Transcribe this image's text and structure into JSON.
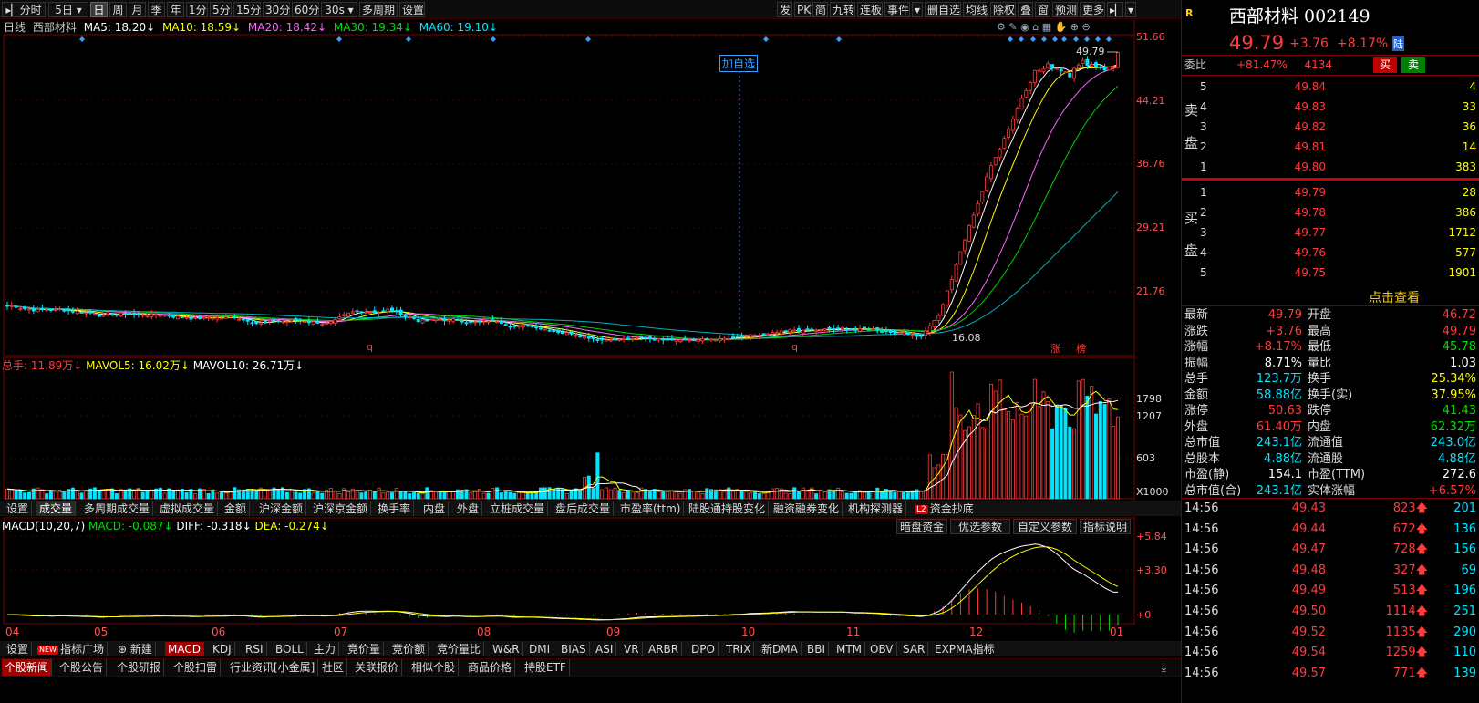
{
  "toolbar": {
    "items": [
      "分时",
      "5日",
      "日",
      "周",
      "月",
      "季",
      "年",
      "1分",
      "5分",
      "15分",
      "30分",
      "60分",
      "30s",
      "多周期",
      "设置"
    ],
    "active": "日",
    "right_items": [
      "发",
      "PK",
      "简",
      "九转",
      "连板",
      "事件",
      "删自选",
      "均线",
      "除权",
      "叠",
      "窗",
      "预测",
      "更多"
    ]
  },
  "ma_line": {
    "period": "日线",
    "name": "西部材料",
    "ma5": "MA5: 18.20↓",
    "ma10": "MA10: 18.59↓",
    "ma20": "MA20: 18.42↓",
    "ma30": "MA30: 19.34↓",
    "ma60": "MA60: 19.10↓"
  },
  "price_axis": [
    "51.66",
    "44.21",
    "36.76",
    "29.21",
    "21.76"
  ],
  "price_annot": {
    "high": "49.79",
    "low": "16.08",
    "add_fav": "加自选",
    "q1": "q",
    "q2": "q",
    "zhang": "涨",
    "bang": "榜"
  },
  "vol_line": {
    "total": "总手: 11.89万↓",
    "mavol5": "MAVOL5: 16.02万↓",
    "mavol10": "MAVOL10: 26.71万↓"
  },
  "vol_axis": [
    "1798",
    "1207",
    "603",
    "X1000"
  ],
  "indicator_tabs": [
    "设置",
    "成交量",
    "多周期成交量",
    "虚拟成交量",
    "金额",
    "沪深金额",
    "沪深京金额",
    "换手率",
    "内盘",
    "外盘",
    "立桩成交量",
    "盘后成交量",
    "市盈率(ttm)",
    "陆股通持股变化",
    "融资融券变化",
    "机构探测器",
    "资金抄底"
  ],
  "indicator_active": "成交量",
  "macd_line": {
    "label": "MACD(10,20,7)",
    "macd": "MACD: -0.087↓",
    "diff": "DIFF: -0.318↓",
    "dea": "DEA: -0.274↓"
  },
  "macd_buttons": [
    "暗盘资金",
    "优选参数",
    "自定义参数",
    "指标说明"
  ],
  "macd_axis": [
    "+5.84",
    "+3.30",
    "+0"
  ],
  "months": [
    "04",
    "05",
    "06",
    "07",
    "08",
    "09",
    "10",
    "11",
    "12",
    "01"
  ],
  "bottom_tabs": [
    "设置",
    "指标广场",
    "新建",
    "MACD",
    "KDJ",
    "RSI",
    "BOLL",
    "主力",
    "竞价量",
    "竞价额",
    "竞价量比",
    "W&R",
    "DMI",
    "BIAS",
    "ASI",
    "VR",
    "ARBR",
    "DPO",
    "TRIX",
    "新DMA",
    "BBI",
    "MTM",
    "OBV",
    "SAR",
    "EXPMA指标"
  ],
  "bottom_active": "MACD",
  "news_tabs": [
    "个股新闻",
    "个股公告",
    "个股研报",
    "个股扫雷",
    "行业资讯[小金属]",
    "社区",
    "关联报价",
    "相似个股",
    "商品价格",
    "持股ETF"
  ],
  "news_active": "个股新闻",
  "stock": {
    "r": "R",
    "name": "西部材料 002149",
    "price": "49.79",
    "change": "+3.76",
    "pct": "+8.17%",
    "lu": "陆"
  },
  "weibi": {
    "label": "委比",
    "pct": "+81.47%",
    "num": "4134",
    "buy": "买",
    "sell": "卖"
  },
  "sell_label": [
    "卖",
    "盘"
  ],
  "buy_label": [
    "买",
    "盘"
  ],
  "asks": [
    {
      "lv": "5",
      "p": "49.84",
      "v": "4"
    },
    {
      "lv": "4",
      "p": "49.83",
      "v": "33"
    },
    {
      "lv": "3",
      "p": "49.82",
      "v": "36"
    },
    {
      "lv": "2",
      "p": "49.81",
      "v": "14"
    },
    {
      "lv": "1",
      "p": "49.80",
      "v": "383"
    }
  ],
  "bids": [
    {
      "lv": "1",
      "p": "49.79",
      "v": "28"
    },
    {
      "lv": "2",
      "p": "49.78",
      "v": "386"
    },
    {
      "lv": "3",
      "p": "49.77",
      "v": "1712"
    },
    {
      "lv": "4",
      "p": "49.76",
      "v": "577"
    },
    {
      "lv": "5",
      "p": "49.75",
      "v": "1901"
    }
  ],
  "view_more": "点击查看",
  "quote": [
    [
      "最新",
      "49.79",
      "开盘",
      "46.72"
    ],
    [
      "涨跌",
      "+3.76",
      "最高",
      "49.79"
    ],
    [
      "涨幅",
      "+8.17%",
      "最低",
      "45.78"
    ],
    [
      "振幅",
      "8.71%",
      "量比",
      "1.03"
    ],
    [
      "总手",
      "123.7万",
      "换手",
      "25.34%"
    ],
    [
      "金额",
      "58.88亿",
      "换手(实)",
      "37.95%"
    ],
    [
      "涨停",
      "50.63",
      "跌停",
      "41.43"
    ],
    [
      "外盘",
      "61.40万",
      "内盘",
      "62.32万"
    ],
    [
      "总市值",
      "243.1亿",
      "流通值",
      "243.0亿"
    ],
    [
      "总股本",
      "4.88亿",
      "流通股",
      "4.88亿"
    ],
    [
      "市盈(静)",
      "154.1",
      "市盈(TTM)",
      "272.6"
    ],
    [
      "总市值(合)",
      "243.1亿",
      "实体涨幅",
      "+6.57%"
    ]
  ],
  "ticks": [
    [
      "14:56",
      "49.43",
      "823",
      "201"
    ],
    [
      "14:56",
      "49.44",
      "672",
      "136"
    ],
    [
      "14:56",
      "49.47",
      "728",
      "156"
    ],
    [
      "14:56",
      "49.48",
      "327",
      "69"
    ],
    [
      "14:56",
      "49.49",
      "513",
      "196"
    ],
    [
      "14:56",
      "49.50",
      "1114",
      "251"
    ],
    [
      "14:56",
      "49.52",
      "1135",
      "290"
    ],
    [
      "14:56",
      "49.54",
      "1259",
      "110"
    ],
    [
      "14:56",
      "49.57",
      "771",
      "139"
    ]
  ],
  "colors": {
    "up": "#ff3b3b",
    "down": "#00e5ff",
    "ma5": "#ffffff",
    "ma10": "#ffff00",
    "ma20": "#ff66ff",
    "ma30": "#00d000",
    "ma60": "#00b0c0",
    "frame": "#800000"
  },
  "chart_data": {
    "type": "candlestick",
    "price_range": [
      16.08,
      51.66
    ],
    "last_close": 49.79,
    "high": 49.79,
    "low": 16.08,
    "vol_range": [
      0,
      1798
    ],
    "macd_range": [
      0,
      5.84
    ]
  }
}
